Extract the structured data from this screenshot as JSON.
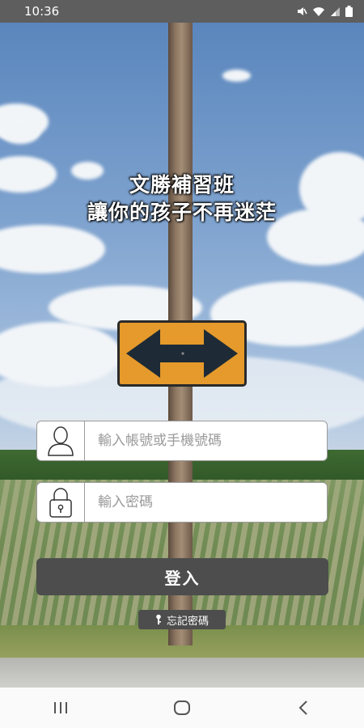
{
  "status_bar": {
    "time": "10:36"
  },
  "header": {
    "line1": "文勝補習班",
    "line2": "讓你的孩子不再迷茫"
  },
  "login_form": {
    "account_placeholder": "輸入帳號或手機號碼",
    "password_placeholder": "輸入密碼",
    "login_label": "登入",
    "forgot_label": "忘記密碼"
  },
  "icons": {
    "account": "user-icon",
    "password": "lock-icon",
    "forgot": "key-icon",
    "nav_recent": "recent-apps-icon",
    "nav_home": "home-icon",
    "nav_back": "back-icon"
  },
  "colors": {
    "status_bar": "#5e5e5e",
    "button": "#4d4d4d",
    "sign": "#e59a2b"
  }
}
